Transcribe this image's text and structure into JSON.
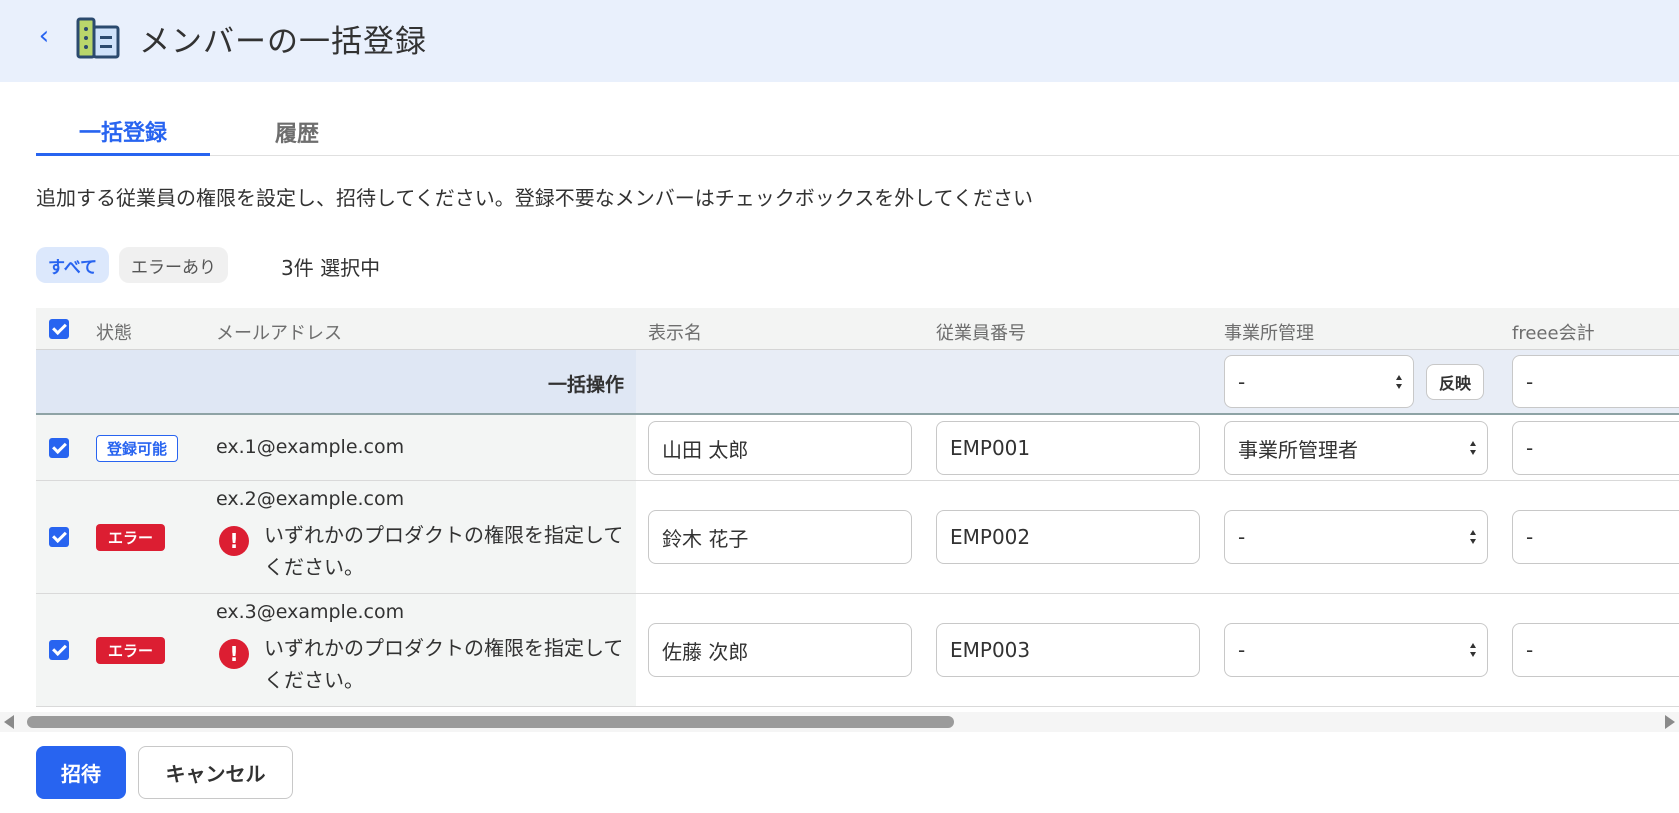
{
  "header": {
    "title": "メンバーの一括登録",
    "back_icon": "chevron-left-icon",
    "app_icon": "building-icon"
  },
  "tabs": [
    {
      "label": "一括登録",
      "active": true
    },
    {
      "label": "履歴",
      "active": false
    }
  ],
  "description": "追加する従業員の権限を設定し、招待してください。登録不要なメンバーはチェックボックスを外してください",
  "filters": {
    "all": "すべて",
    "errors": "エラーあり",
    "selected_count": "3件 選択中"
  },
  "table": {
    "columns": [
      "状態",
      "メールアドレス",
      "表示名",
      "従業員番号",
      "事業所管理",
      "freee会計"
    ],
    "bulk": {
      "label": "一括操作",
      "office_value": "-",
      "reflect_label": "反映",
      "freee_value": "-"
    },
    "rows": [
      {
        "checked": true,
        "status": "登録可能",
        "status_type": "ok",
        "email": "ex.1@example.com",
        "error": "",
        "display_name": "山田 太郎",
        "employee_no": "EMP001",
        "office_admin": "事業所管理者",
        "freee": "-"
      },
      {
        "checked": true,
        "status": "エラー",
        "status_type": "error",
        "email": "ex.2@example.com",
        "error": "いずれかのプロダクトの権限を指定してください。",
        "display_name": "鈴木 花子",
        "employee_no": "EMP002",
        "office_admin": "-",
        "freee": "-"
      },
      {
        "checked": true,
        "status": "エラー",
        "status_type": "error",
        "email": "ex.3@example.com",
        "error": "いずれかのプロダクトの権限を指定してください。",
        "display_name": "佐藤 次郎",
        "employee_no": "EMP003",
        "office_admin": "-",
        "freee": "-"
      }
    ]
  },
  "actions": {
    "invite": "招待",
    "cancel": "キャンセル"
  },
  "colors": {
    "accent": "#2864f0",
    "error": "#dc1e32",
    "header_bg": "#e9f0fc"
  }
}
